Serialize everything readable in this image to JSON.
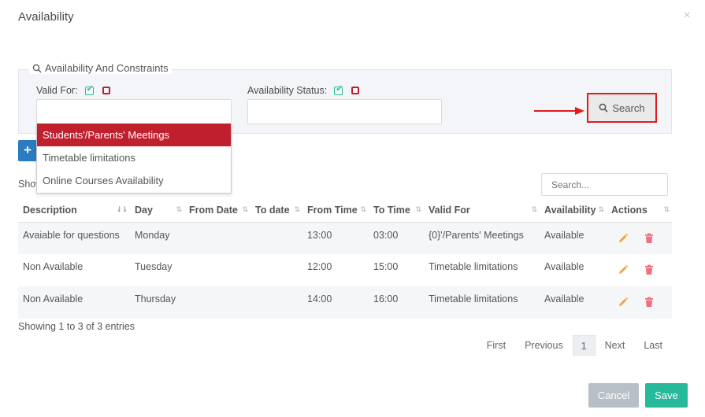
{
  "modal": {
    "title": "Availability",
    "close_glyph": "×"
  },
  "filters": {
    "legend": "Availability And Constraints",
    "valid_for_label": "Valid For:",
    "availability_status_label": "Availability Status:",
    "search_label": "Search",
    "dropdown_options": [
      {
        "label": "Students'/Parents' Meetings",
        "selected": true
      },
      {
        "label": "Timetable limitations",
        "selected": false
      },
      {
        "label": "Online Courses Availability",
        "selected": false
      }
    ]
  },
  "toolbar": {
    "add_label": "+",
    "show_text": "Show",
    "filter_placeholder": "Search..."
  },
  "table": {
    "headers": [
      "Description",
      "Day",
      "From Date",
      "To date",
      "From Time",
      "To Time",
      "Valid For",
      "Availability",
      "Actions"
    ],
    "rows": [
      {
        "description": "Avaiable for questions",
        "day": "Monday",
        "from_date": "",
        "to_date": "",
        "from_time": "13:00",
        "to_time": "03:00",
        "valid_for": "{0}'/Parents' Meetings",
        "availability": "Available"
      },
      {
        "description": "Non Available",
        "day": "Tuesday",
        "from_date": "",
        "to_date": "",
        "from_time": "12:00",
        "to_time": "15:00",
        "valid_for": "Timetable limitations",
        "availability": "Available"
      },
      {
        "description": "Non Available",
        "day": "Thursday",
        "from_date": "",
        "to_date": "",
        "from_time": "14:00",
        "to_time": "16:00",
        "valid_for": "Timetable limitations",
        "availability": "Available"
      }
    ]
  },
  "footer": {
    "info": "Showing 1 to 3 of 3 entries",
    "pagination": {
      "first": "First",
      "previous": "Previous",
      "current": "1",
      "next": "Next",
      "last": "Last"
    },
    "cancel_label": "Cancel",
    "save_label": "Save"
  },
  "colors": {
    "accent_red": "#c0202e",
    "primary_green": "#26b99a",
    "primary_blue": "#2a7bbf",
    "highlight_red": "#e01b1b"
  }
}
